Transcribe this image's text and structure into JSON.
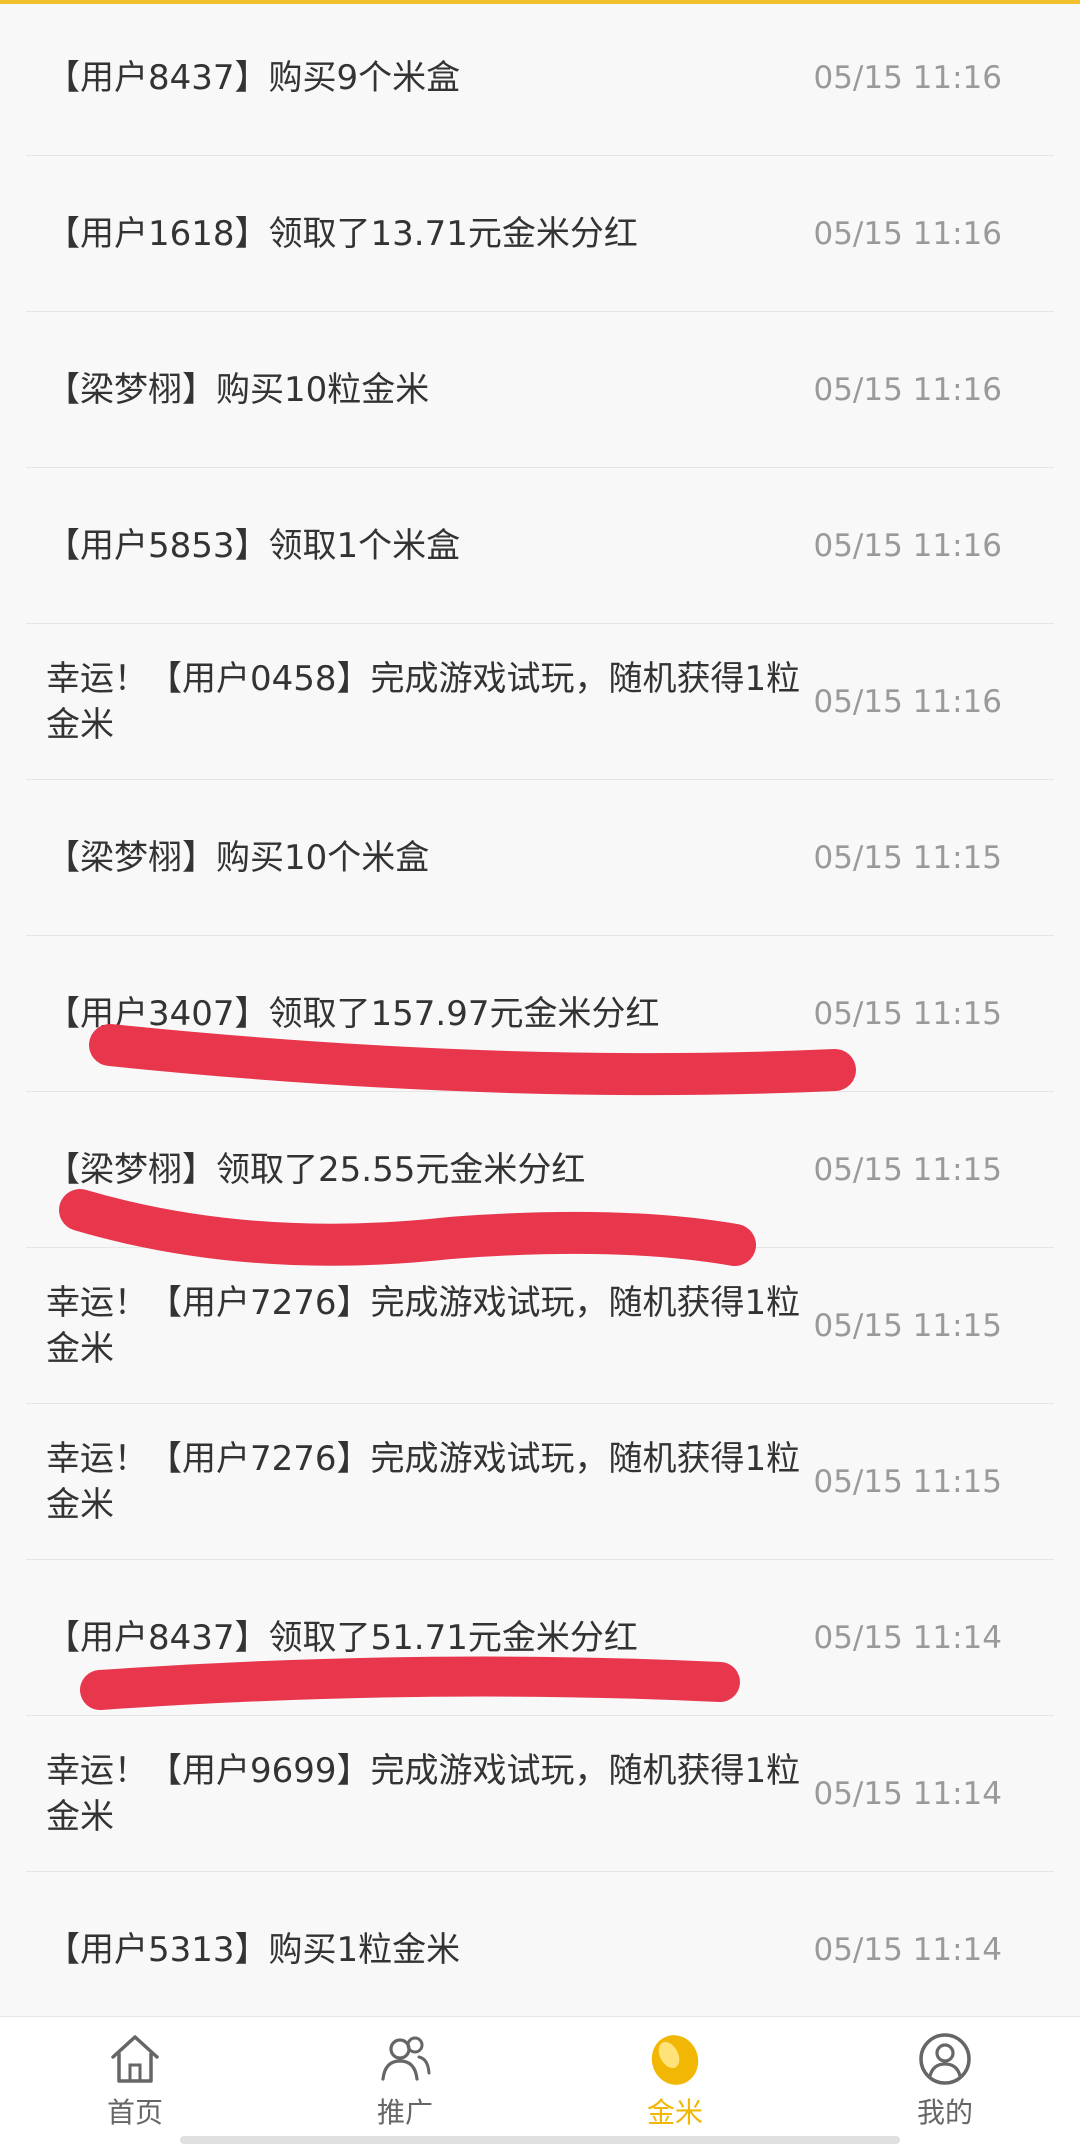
{
  "feed": [
    {
      "text": "【用户8437】购买9个米盒",
      "time": "05/15 11:16"
    },
    {
      "text": "【用户1618】领取了13.71元金米分红",
      "time": "05/15 11:16"
    },
    {
      "text": "【梁梦栩】购买10粒金米",
      "time": "05/15 11:16"
    },
    {
      "text": "【用户5853】领取1个米盒",
      "time": "05/15 11:16"
    },
    {
      "text": "幸运！【用户0458】完成游戏试玩，随机获得1粒金米",
      "time": "05/15 11:16"
    },
    {
      "text": "【梁梦栩】购买10个米盒",
      "time": "05/15 11:15"
    },
    {
      "text": "【用户3407】领取了157.97元金米分红",
      "time": "05/15 11:15"
    },
    {
      "text": "【梁梦栩】领取了25.55元金米分红",
      "time": "05/15 11:15"
    },
    {
      "text": "幸运！【用户7276】完成游戏试玩，随机获得1粒金米",
      "time": "05/15 11:15"
    },
    {
      "text": "幸运！【用户7276】完成游戏试玩，随机获得1粒金米",
      "time": "05/15 11:15"
    },
    {
      "text": "【用户8437】领取了51.71元金米分红",
      "time": "05/15 11:14"
    },
    {
      "text": "幸运！【用户9699】完成游戏试玩，随机获得1粒金米",
      "time": "05/15 11:14"
    },
    {
      "text": "【用户5313】购买1粒金米",
      "time": "05/15 11:14"
    }
  ],
  "tabbar": {
    "tabs": [
      {
        "label": "首页",
        "icon": "home-icon"
      },
      {
        "label": "推广",
        "icon": "users-icon"
      },
      {
        "label": "金米",
        "icon": "gold-rice-icon"
      },
      {
        "label": "我的",
        "icon": "profile-icon"
      }
    ],
    "active_index": 2
  },
  "colors": {
    "accent": "#f2b705",
    "scribble": "#e8364c",
    "text": "#333333",
    "time": "#9a9a9a"
  }
}
